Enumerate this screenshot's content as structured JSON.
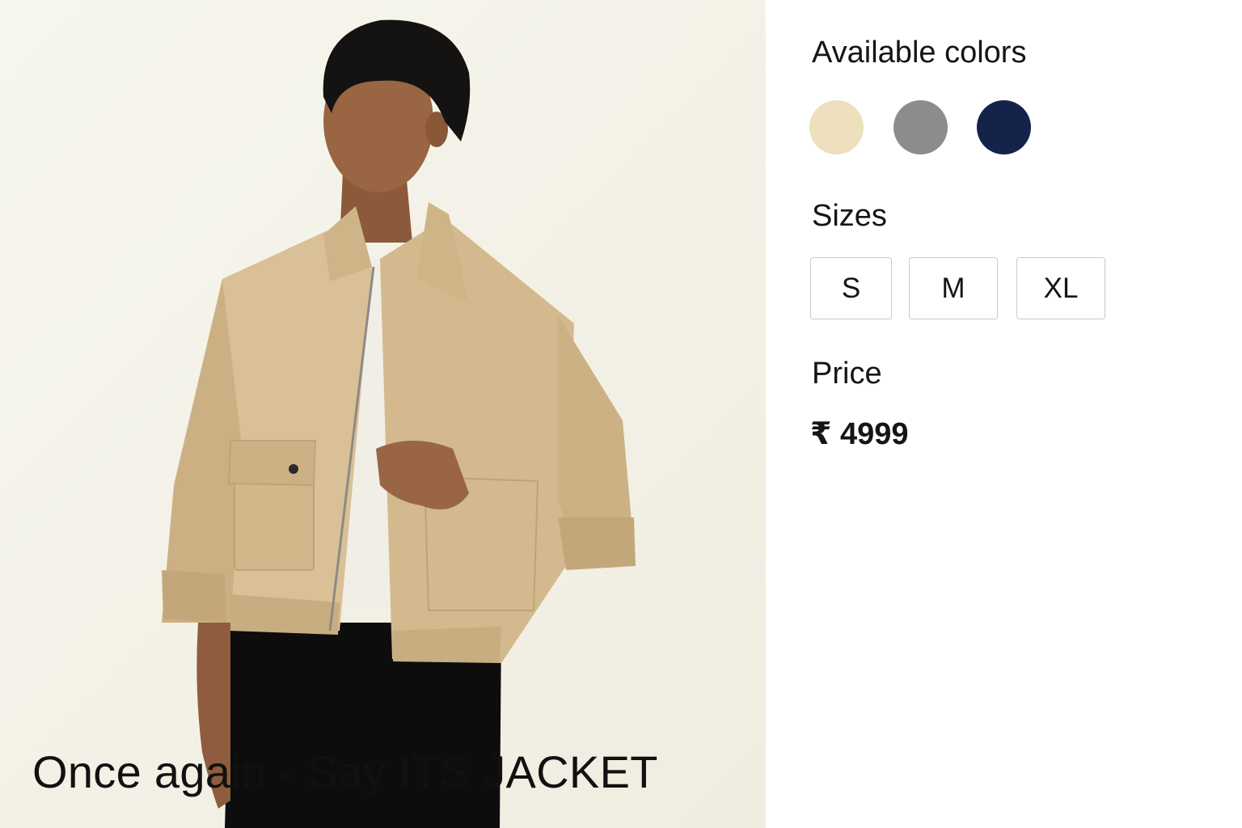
{
  "product": {
    "caption": "Once again - Say ITS JACKET",
    "colors_title": "Available colors",
    "colors": [
      {
        "name": "beige",
        "hex": "#EEDFBD"
      },
      {
        "name": "grey",
        "hex": "#8B8C8E"
      },
      {
        "name": "navy",
        "hex": "#15224A"
      }
    ],
    "sizes_title": "Sizes",
    "sizes": [
      "S",
      "M",
      "XL"
    ],
    "price_title": "Price",
    "price": "₹ 4999"
  }
}
